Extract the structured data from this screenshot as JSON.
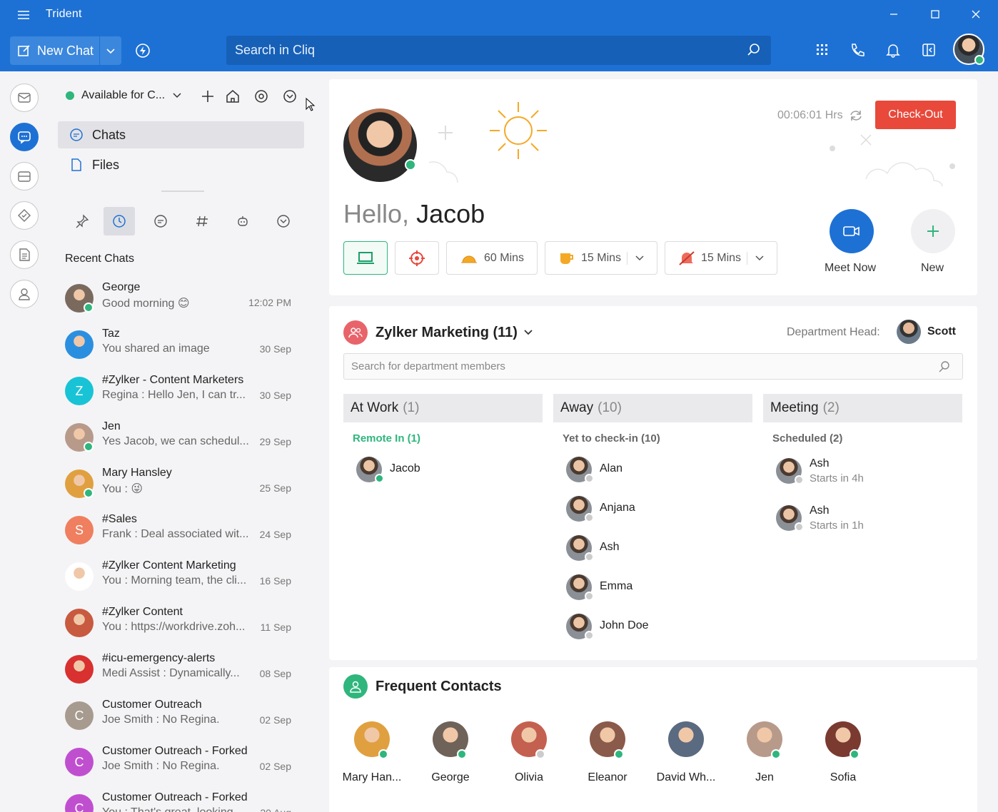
{
  "window": {
    "title": "Trident"
  },
  "toolbar": {
    "new_chat": "New Chat",
    "search_placeholder": "Search in Cliq"
  },
  "sidebar": {
    "status": "Available for C...",
    "nav": [
      {
        "label": "Chats"
      },
      {
        "label": "Files"
      }
    ],
    "recent_title": "Recent Chats",
    "chats": [
      {
        "name": "George",
        "message": "Good morning 😊",
        "time": "12:02 PM",
        "color": "#7a6a5e",
        "initial": ""
      },
      {
        "name": "Taz",
        "message": "You shared an image",
        "time": "30 Sep",
        "color": "#2b8fe0",
        "initial": ""
      },
      {
        "name": "#Zylker - Content Marketers",
        "message": "Regina : Hello Jen, I can tr...",
        "time": "30 Sep",
        "color": "#19c3d6",
        "initial": "Z"
      },
      {
        "name": "Jen",
        "message": "Yes Jacob, we can schedul...",
        "time": "29 Sep",
        "color": "#b89a8a",
        "initial": ""
      },
      {
        "name": "Mary Hansley",
        "message": "You : 😜",
        "time": "25 Sep",
        "color": "#e0a040",
        "initial": ""
      },
      {
        "name": "#Sales",
        "message": "Frank : Deal associated wit...",
        "time": "24 Sep",
        "color": "#ef7f5f",
        "initial": "S"
      },
      {
        "name": "#Zylker Content Marketing",
        "message": "You : Morning team, the cli...",
        "time": "16 Sep",
        "color": "#ffffff",
        "initial": ""
      },
      {
        "name": "#Zylker Content",
        "message": "You : https://workdrive.zoh...",
        "time": "11 Sep",
        "color": "#c85a40",
        "initial": ""
      },
      {
        "name": "#icu-emergency-alerts",
        "message": "Medi Assist : Dynamically...",
        "time": "08 Sep",
        "color": "#d93030",
        "initial": ""
      },
      {
        "name": "Customer Outreach",
        "message": "Joe Smith : No Regina.",
        "time": "02 Sep",
        "color": "#a79a8f",
        "initial": "C"
      },
      {
        "name": "Customer Outreach - Forked",
        "message": "Joe Smith : No Regina.",
        "time": "02 Sep",
        "color": "#c04fd0",
        "initial": "C"
      },
      {
        "name": "Customer Outreach - Forked",
        "message": "You : That's great, looking...",
        "time": "20 Aug",
        "color": "#c04fd0",
        "initial": "C"
      }
    ]
  },
  "greeting": {
    "hello": "Hello,",
    "name": "Jacob",
    "timer": "00:06:01 Hrs",
    "checkout": "Check-Out",
    "break1": "60 Mins",
    "break2": "15 Mins",
    "break3": "15 Mins",
    "meet_now": "Meet Now",
    "new": "New"
  },
  "department": {
    "title": "Zylker Marketing (11)",
    "head_label": "Department Head:",
    "head_name": "Scott",
    "search_placeholder": "Search for department members",
    "columns": [
      {
        "title": "At Work",
        "count": "(1)",
        "sub": "Remote In (1)",
        "sub_color": "#2eb67d",
        "members": [
          {
            "name": "Jacob",
            "detail": "",
            "status": "#2eb67d"
          }
        ]
      },
      {
        "title": "Away",
        "count": "(10)",
        "sub": "Yet to check-in (10)",
        "sub_color": "#666666",
        "members": [
          {
            "name": "Alan",
            "detail": "",
            "status": "#cccccc"
          },
          {
            "name": "Anjana",
            "detail": "",
            "status": "#cccccc"
          },
          {
            "name": "Ash",
            "detail": "",
            "status": "#cccccc"
          },
          {
            "name": "Emma",
            "detail": "",
            "status": "#cccccc"
          },
          {
            "name": "John Doe",
            "detail": "",
            "status": "#cccccc"
          }
        ]
      },
      {
        "title": "Meeting",
        "count": "(2)",
        "sub": "Scheduled (2)",
        "sub_color": "#666666",
        "members": [
          {
            "name": "Ash",
            "detail": "Starts in 4h",
            "status": "#cccccc"
          },
          {
            "name": "Ash",
            "detail": "Starts in 1h",
            "status": "#cccccc"
          }
        ]
      }
    ]
  },
  "frequent": {
    "title": "Frequent Contacts",
    "contacts": [
      {
        "name": "Mary Han...",
        "status": "#2eb67d",
        "color": "#e0a040"
      },
      {
        "name": "George",
        "status": "#2eb67d",
        "color": "#6f6258"
      },
      {
        "name": "Olivia",
        "status": "#cccccc",
        "color": "#c46050"
      },
      {
        "name": "Eleanor",
        "status": "#2eb67d",
        "color": "#8a5a4a"
      },
      {
        "name": "David Wh...",
        "status": "",
        "color": "#5a6a80"
      },
      {
        "name": "Jen",
        "status": "#2eb67d",
        "color": "#b89a8a"
      },
      {
        "name": "Sofia",
        "status": "#2eb67d",
        "color": "#7a3a30"
      }
    ]
  }
}
